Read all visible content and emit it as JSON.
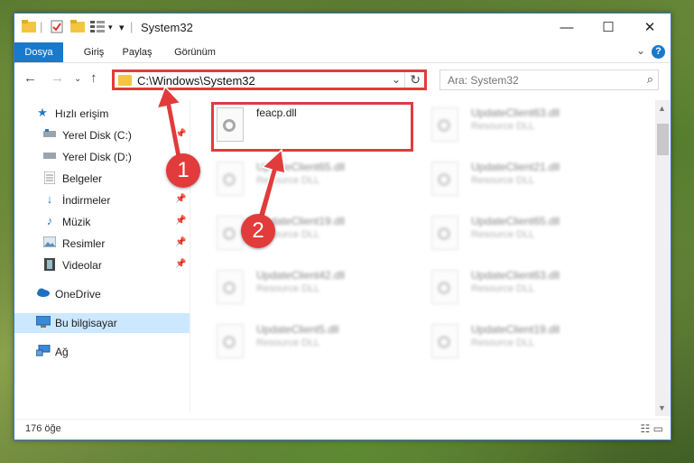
{
  "window": {
    "title": "System32",
    "controls": {
      "minimize": "—",
      "maximize": "☐",
      "close": "✕"
    }
  },
  "ribbon": {
    "tabs": [
      "Dosya",
      "Giriş",
      "Paylaş",
      "Görünüm"
    ],
    "help": "?"
  },
  "address": {
    "path": "C:\\Windows\\System32",
    "search_placeholder": "Ara: System32"
  },
  "nav": {
    "items": [
      {
        "label": "Hızlı erişim",
        "icon": "star-icon"
      },
      {
        "label": "Yerel Disk (C:)",
        "icon": "drive-icon",
        "pinned": true
      },
      {
        "label": "Yerel Disk (D:)",
        "icon": "drive-icon"
      },
      {
        "label": "Belgeler",
        "icon": "documents-icon",
        "pinned": true
      },
      {
        "label": "İndirmeler",
        "icon": "download-icon",
        "pinned": true
      },
      {
        "label": "Müzik",
        "icon": "music-icon",
        "pinned": true
      },
      {
        "label": "Resimler",
        "icon": "pictures-icon",
        "pinned": true
      },
      {
        "label": "Videolar",
        "icon": "video-icon",
        "pinned": true
      },
      {
        "label": "OneDrive",
        "icon": "cloud-icon"
      },
      {
        "label": "Bu bilgisayar",
        "icon": "computer-icon",
        "selected": true
      },
      {
        "label": "Ağ",
        "icon": "network-icon"
      }
    ]
  },
  "files": {
    "highlighted": {
      "name": "feacp.dll",
      "type": ""
    },
    "left": [
      {
        "name": "UpdateClient65.dll",
        "type": "Resource DLL"
      },
      {
        "name": "UpdateClient19.dll",
        "type": "Resource DLL"
      },
      {
        "name": "UpdateClient42.dll",
        "type": "Resource DLL"
      },
      {
        "name": "UpdateClient5.dll",
        "type": "Resource DLL"
      }
    ],
    "right": [
      {
        "name": "UpdateClient63.dll",
        "type": "Resource DLL"
      },
      {
        "name": "UpdateClient21.dll",
        "type": "Resource DLL"
      },
      {
        "name": "UpdateClient65.dll",
        "type": "Resource DLL"
      },
      {
        "name": "UpdateClient63.dll",
        "type": "Resource DLL"
      },
      {
        "name": "UpdateClient19.dll",
        "type": "Resource DLL"
      }
    ]
  },
  "status": {
    "count": "176 öğe"
  },
  "annotations": {
    "step1": "1",
    "step2": "2"
  },
  "colors": {
    "accent": "#1979ca",
    "annotation": "#e23b3b",
    "selected": "#cce8ff"
  }
}
